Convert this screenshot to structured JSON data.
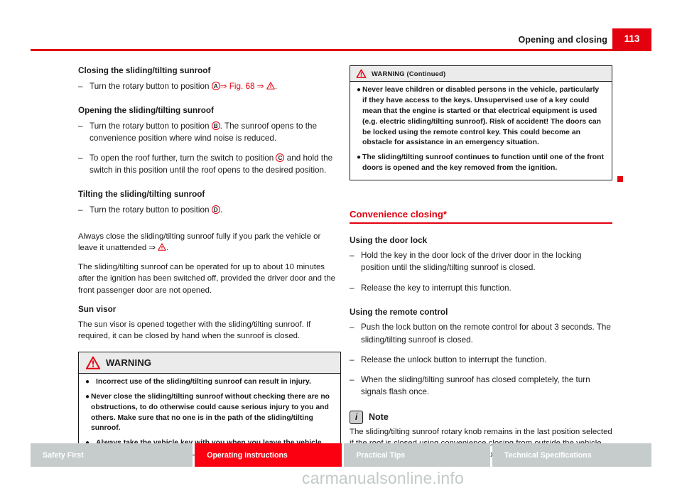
{
  "header": {
    "title": "Opening and closing",
    "page_number": "113"
  },
  "left_column": {
    "closing_heading": "Closing the sliding/tilting sunroof",
    "closing_step": {
      "prefix": "Turn the rotary button to position ",
      "marker": "A",
      "xref": "⇒ Fig. 68",
      "mid": " ⇒ ",
      "suffix": "."
    },
    "opening_heading": "Opening the sliding/tilting sunroof",
    "opening_step_1": {
      "prefix": "Turn the rotary button to position ",
      "marker": "B",
      "suffix": ". The sunroof opens to the convenience position where wind noise is reduced."
    },
    "opening_step_2": {
      "prefix": "To open the roof further, turn the switch to position ",
      "marker": "C",
      "suffix": " and hold the switch in this position until the roof opens to the desired position."
    },
    "tilting_heading": "Tilting the sliding/tilting sunroof",
    "tilting_step": {
      "prefix": "Turn the rotary button to position ",
      "marker": "D",
      "suffix": "."
    },
    "para_always_close": {
      "prefix": "Always close the sliding/tilting sunroof fully if you park the vehicle or leave it unattended ⇒ ",
      "suffix": "."
    },
    "para_ten_minutes": "The sliding/tilting sunroof can be operated for up to about 10 minutes after the ignition has been switched off, provided the driver door and the front passenger door are not opened.",
    "sun_visor_heading": "Sun visor",
    "sun_visor_text": "The sun visor is opened together with the sliding/tilting sunroof. If required, it can be closed by hand when the sunroof is closed.",
    "warning_box": {
      "title": "WARNING",
      "bullets": [
        "Incorrect use of the sliding/tilting sunroof can result in injury.",
        "Never close the sliding/tilting sunroof without checking there are no obstructions, to do otherwise could cause serious injury to you and others. Make sure that no one is in the path of the sliding/tilting sunroof.",
        "Always take the vehicle key with you when you leave the vehicle."
      ]
    }
  },
  "right_column": {
    "warning_continued_box": {
      "title": "WARNING (Continued)",
      "bullets": [
        "Never leave children or disabled persons in the vehicle, particularly if they have access to the keys. Unsupervised use of a key could mean that the engine is started or that electrical equipment is used (e.g. electric sliding/tilting sunroof). Risk of accident! The doors can be locked using the remote control key. This could become an obstacle for assistance in an emergency situation.",
        "The sliding/tilting sunroof continues to function until one of the front doors is opened and the key removed from the ignition."
      ]
    },
    "section_heading": "Convenience closing*",
    "door_lock_heading": "Using the door lock",
    "door_lock_steps": [
      "Hold the key in the door lock of the driver door in the locking position until the sliding/tilting sunroof is closed.",
      "Release the key to interrupt this function."
    ],
    "remote_heading": "Using the remote control",
    "remote_steps": [
      "Push the lock button on the remote control for about 3 seconds. The sliding/tilting sunroof is closed.",
      "Release the unlock button to interrupt the function.",
      "When the sliding/tilting sunroof has closed completely, the turn signals flash once."
    ],
    "note": {
      "label": "Note",
      "icon": "info-icon",
      "text": "The sliding/tilting sunroof rotary knob remains in the last position selected if the roof is closed using convenience closing from outside the vehicle and will have to be re-positioned the next time you drive."
    }
  },
  "footer": {
    "tabs": [
      {
        "label": "Safety First",
        "active": false
      },
      {
        "label": "Operating instructions",
        "active": true
      },
      {
        "label": "Practical Tips",
        "active": false
      },
      {
        "label": "Technical Specifications",
        "active": false
      }
    ]
  },
  "watermark": "carmanualsonline.info",
  "colors": {
    "brand_red": "#e3000f",
    "tab_red": "#fb0010",
    "tab_gray": "#c6cccc",
    "notice_header_gray": "#ebebeb",
    "watermark_gray": "#c3c8c8"
  }
}
